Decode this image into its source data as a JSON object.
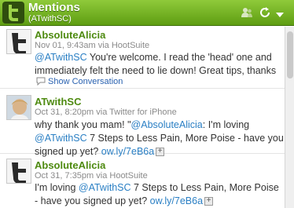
{
  "header": {
    "title": "Mentions",
    "subtitle": "(ATwithSC)",
    "icons": [
      "twitter-logo",
      "user-icon",
      "refresh-icon",
      "dropdown-arrow"
    ]
  },
  "tweets": [
    {
      "author": "AbsoluteAlicia",
      "meta": "Nov 01, 9:43am via HootSuite",
      "mention": "@ATwithSC",
      "text_after": " You're welcome. I read the 'head' one and immediately felt the need to lie down! Great tips, thanks",
      "conversation": "Show Conversation"
    },
    {
      "author": "ATwithSC",
      "meta": "Oct 31, 8:20pm via Twitter for iPhone",
      "text_before": "why thank you mam! \"",
      "mention1": "@AbsoluteAlicia",
      "text_mid": ": I'm loving ",
      "mention2": "@ATwithSC",
      "text_after": " 7 Steps to Less Pain, More Poise - have you signed up yet? ",
      "link": "ow.ly/7eB6a"
    },
    {
      "author": "AbsoluteAlicia",
      "meta": "Oct 31, 7:35pm via HootSuite",
      "text_before": "I'm loving ",
      "mention": "@ATwithSC",
      "text_after": " 7 Steps to Less Pain, More Poise - have you signed up yet? ",
      "link": "ow.ly/7eB6a"
    }
  ],
  "colors": {
    "header_green": "#6aa81c",
    "author_green": "#4e8a10",
    "link_blue": "#2a7fc4"
  }
}
